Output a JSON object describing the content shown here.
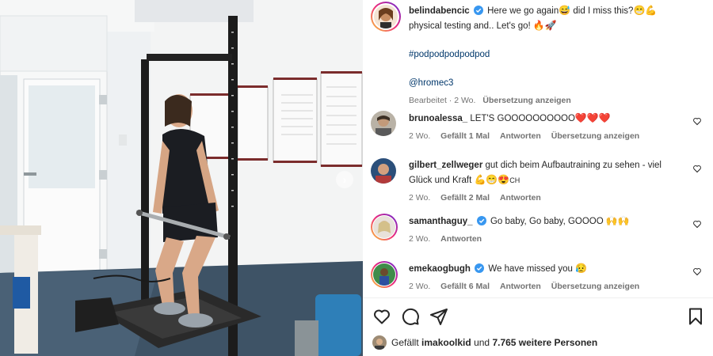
{
  "post": {
    "author": "belindabencic",
    "caption_line1": "Here we go again",
    "caption_emoji1": "😅",
    "caption_line1b": " did I miss this?",
    "caption_emoji2": "😁💪",
    "caption_line2": "physical testing and.. Let's go! ",
    "caption_emoji3": "🔥🚀",
    "hashtag": "#podpodpodpodpod",
    "mention": "@hromec3",
    "edited": "Bearbeitet · 2 Wo.",
    "translate": "Übersetzung anzeigen"
  },
  "comments": [
    {
      "user": "brunoalessa_",
      "text": "LET'S GOOOOOOOOOO",
      "emoji": "❤️❤️❤️",
      "time": "2 Wo.",
      "likes": "Gefällt 1 Mal",
      "reply": "Antworten",
      "translate": "Übersetzung anzeigen",
      "verified": false
    },
    {
      "user": "gilbert_zellweger",
      "text": "gut dich beim Aufbautraining zu sehen - viel Glück und Kraft",
      "emoji": "💪😁😍",
      "suffix": "CH",
      "time": "2 Wo.",
      "likes": "Gefällt 2 Mal",
      "reply": "Antworten",
      "verified": false
    },
    {
      "user": "samanthaguy_",
      "text": "Go baby, Go baby, GOOOO",
      "emoji": "🙌🙌",
      "time": "2 Wo.",
      "reply": "Antworten",
      "verified": true
    },
    {
      "user": "emekaogbugh",
      "text": "We have missed you",
      "emoji": "😥",
      "time": "2 Wo.",
      "likes": "Gefällt 6 Mal",
      "reply": "Antworten",
      "translate": "Übersetzung anzeigen",
      "verified": true
    }
  ],
  "likes_bar": {
    "prefix": "Gefällt",
    "user": "imakoolkid",
    "middle": "und",
    "count": "7.765 weitere Personen"
  },
  "colors": {
    "verified": "#3897f0",
    "link": "#00376b",
    "meta": "#737373"
  },
  "icons": [
    "heart-icon",
    "comment-icon",
    "share-icon",
    "bookmark-icon",
    "chevron-right-icon",
    "verified-icon"
  ]
}
